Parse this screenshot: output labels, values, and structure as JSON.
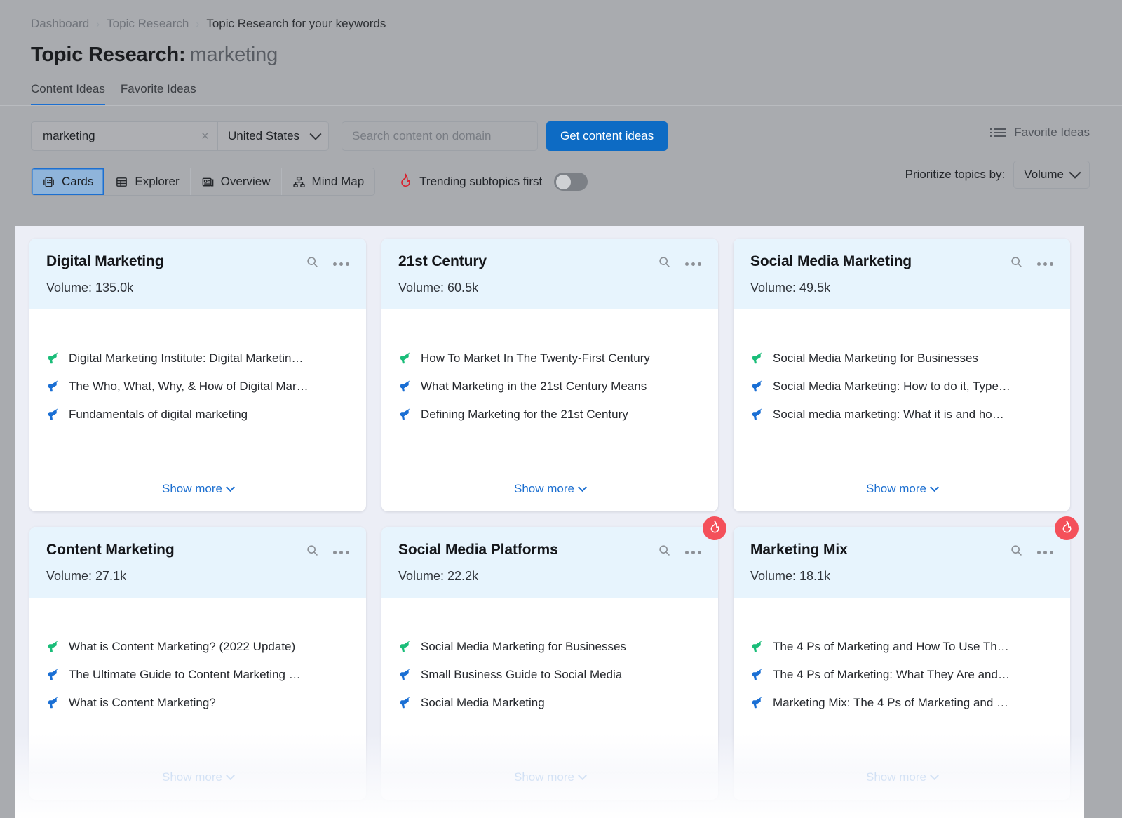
{
  "breadcrumb": {
    "items": [
      "Dashboard",
      "Topic Research",
      "Topic Research for your keywords"
    ],
    "separator": "›"
  },
  "header": {
    "title": "Topic Research:",
    "keyword": "marketing"
  },
  "tabs": [
    {
      "label": "Content Ideas",
      "active": true
    },
    {
      "label": "Favorite Ideas",
      "active": false
    }
  ],
  "toolbar": {
    "keyword_value": "marketing",
    "clear_label": "×",
    "database_value": "United States",
    "domain_placeholder": "Search content on domain",
    "domain_value": "",
    "get_ideas_label": "Get content ideas",
    "favorite_ideas_label": "Favorite Ideas",
    "views": [
      {
        "label": "Cards",
        "icon": "cards-icon",
        "active": true
      },
      {
        "label": "Explorer",
        "icon": "table-icon",
        "active": false
      },
      {
        "label": "Overview",
        "icon": "overview-icon",
        "active": false
      },
      {
        "label": "Mind Map",
        "icon": "mindmap-icon",
        "active": false
      }
    ],
    "trending_label": "Trending subtopics first",
    "trending_on": false,
    "prioritize_label": "Prioritize topics by:",
    "prioritize_value": "Volume"
  },
  "colors": {
    "accent_blue": "#0d6bc4",
    "link_blue": "#1c6fd0",
    "card_head_bg": "#e7f4fd",
    "flame_red": "#f4505a",
    "green_megaphone": "#1abd79",
    "blue_megaphone": "#1a6fd4",
    "panel_bg": "#eceef6",
    "veil_grey": "#a9abaf"
  },
  "show_more_label": "Show more",
  "volume_prefix": "Volume: ",
  "cards": [
    {
      "title": "Digital Marketing",
      "volume": "Volume: 135.0k",
      "trending": false,
      "ideas": [
        {
          "text": "Digital Marketing Institute: Digital Marketin…",
          "color": "green"
        },
        {
          "text": "The Who, What, Why, & How of Digital Mar…",
          "color": "blue"
        },
        {
          "text": "Fundamentals of digital marketing",
          "color": "blue"
        }
      ],
      "show_more": "Show more"
    },
    {
      "title": "21st Century",
      "volume": "Volume: 60.5k",
      "trending": false,
      "ideas": [
        {
          "text": "How To Market In The Twenty-First Century",
          "color": "green"
        },
        {
          "text": "What Marketing in the 21st Century Means",
          "color": "blue"
        },
        {
          "text": "Defining Marketing for the 21st Century",
          "color": "blue"
        }
      ],
      "show_more": "Show more"
    },
    {
      "title": "Social Media Marketing",
      "volume": "Volume: 49.5k",
      "trending": false,
      "ideas": [
        {
          "text": "Social Media Marketing for Businesses",
          "color": "green"
        },
        {
          "text": "Social Media Marketing: How to do it, Type…",
          "color": "blue"
        },
        {
          "text": "Social media marketing: What it is and ho…",
          "color": "blue"
        }
      ],
      "show_more": "Show more"
    },
    {
      "title": "Content Marketing",
      "volume": "Volume: 27.1k",
      "trending": false,
      "ideas": [
        {
          "text": "What is Content Marketing? (2022 Update)",
          "color": "green"
        },
        {
          "text": "The Ultimate Guide to Content Marketing …",
          "color": "blue"
        },
        {
          "text": "What is Content Marketing?",
          "color": "blue"
        }
      ],
      "show_more": "Show more"
    },
    {
      "title": "Social Media Platforms",
      "volume": "Volume: 22.2k",
      "trending": true,
      "ideas": [
        {
          "text": "Social Media Marketing for Businesses",
          "color": "green"
        },
        {
          "text": "Small Business Guide to Social Media",
          "color": "blue"
        },
        {
          "text": "Social Media Marketing",
          "color": "blue"
        }
      ],
      "show_more": "Show more"
    },
    {
      "title": "Marketing Mix",
      "volume": "Volume: 18.1k",
      "trending": true,
      "ideas": [
        {
          "text": "The 4 Ps of Marketing and How To Use Th…",
          "color": "green"
        },
        {
          "text": "The 4 Ps of Marketing: What They Are and…",
          "color": "blue"
        },
        {
          "text": "Marketing Mix: The 4 Ps of Marketing and …",
          "color": "blue"
        }
      ],
      "show_more": "Show more"
    }
  ]
}
